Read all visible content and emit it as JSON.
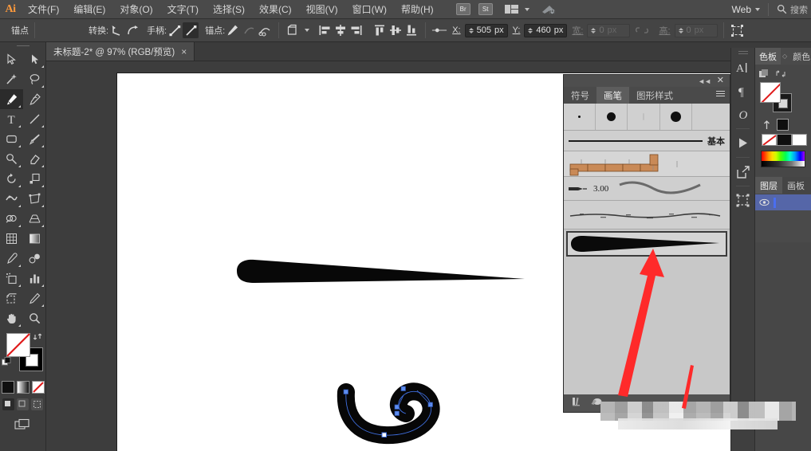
{
  "app": {
    "logo": "Ai",
    "accent_orange": "#ff9a3c",
    "chrome_bg": "#3d3d3d"
  },
  "menubar": {
    "items": [
      {
        "label": "文件(F)"
      },
      {
        "label": "编辑(E)"
      },
      {
        "label": "对象(O)"
      },
      {
        "label": "文字(T)"
      },
      {
        "label": "选择(S)"
      },
      {
        "label": "效果(C)"
      },
      {
        "label": "视图(V)"
      },
      {
        "label": "窗口(W)"
      },
      {
        "label": "帮助(H)"
      }
    ],
    "bridge_button": "Br",
    "stock_button": "St",
    "workspace": "Web",
    "search_placeholder": "搜索"
  },
  "controlbar": {
    "context_label": "锚点",
    "convert_label": "转换:",
    "handles_label": "手柄:",
    "anchors_label": "锚点:",
    "x_label": "X:",
    "x_value": "505",
    "x_unit": "px",
    "y_label": "Y:",
    "y_value": "460",
    "y_unit": "px",
    "w_label": "宽:",
    "w_value": "0",
    "w_unit": "px",
    "h_label": "高:",
    "h_value": "0",
    "h_unit": "px"
  },
  "document": {
    "tab_title": "未标题-2* @ 97% (RGB/预览)",
    "close_label": "×",
    "zoom": "97%",
    "color_mode": "RGB",
    "view_mode": "预览"
  },
  "toolbar": {
    "tools": [
      {
        "name": "selection-tool"
      },
      {
        "name": "direct-selection-tool"
      },
      {
        "name": "magic-wand-tool"
      },
      {
        "name": "lasso-tool"
      },
      {
        "name": "pen-tool",
        "active": true
      },
      {
        "name": "curvature-tool"
      },
      {
        "name": "type-tool"
      },
      {
        "name": "line-segment-tool"
      },
      {
        "name": "rectangle-tool"
      },
      {
        "name": "paintbrush-tool"
      },
      {
        "name": "shaper-tool"
      },
      {
        "name": "eraser-tool"
      },
      {
        "name": "rotate-tool"
      },
      {
        "name": "scale-tool"
      },
      {
        "name": "width-tool"
      },
      {
        "name": "free-transform-tool"
      },
      {
        "name": "shape-builder-tool"
      },
      {
        "name": "perspective-grid-tool"
      },
      {
        "name": "mesh-tool"
      },
      {
        "name": "gradient-tool"
      },
      {
        "name": "eyedropper-tool"
      },
      {
        "name": "blend-tool"
      },
      {
        "name": "symbol-sprayer-tool"
      },
      {
        "name": "column-graph-tool"
      },
      {
        "name": "artboard-tool"
      },
      {
        "name": "slice-tool"
      },
      {
        "name": "hand-tool"
      },
      {
        "name": "zoom-tool"
      }
    ],
    "fill_color": "#ffffff",
    "fill_is_none": true,
    "stroke_color": "#000000",
    "color_mode_buttons": [
      "color-swatch",
      "gradient-swatch",
      "none-swatch"
    ],
    "draw_modes": [
      "draw-normal",
      "draw-behind",
      "draw-inside"
    ]
  },
  "brushes_panel": {
    "tabs": [
      {
        "label": "符号",
        "active": false
      },
      {
        "label": "画笔",
        "active": true
      },
      {
        "label": "图形样式",
        "active": false
      }
    ],
    "thumbnails": [
      {
        "name": "brush-thumb-tiny-dot",
        "size": 3
      },
      {
        "name": "brush-thumb-round-dot",
        "size": 11
      },
      {
        "name": "brush-thumb-soft",
        "size": 2
      },
      {
        "name": "brush-thumb-large-dot",
        "size": 13
      }
    ],
    "brushes": [
      {
        "name": "basic-brush",
        "label": "基本",
        "type": "calligraphic"
      },
      {
        "name": "pattern-brush",
        "label": "",
        "type": "pattern"
      },
      {
        "name": "art-brush-300",
        "label": "3.00",
        "type": "art"
      },
      {
        "name": "charcoal-brush",
        "label": "",
        "type": "bristle"
      },
      {
        "name": "tapered-stroke-brush",
        "label": "",
        "type": "art",
        "selected": true
      }
    ],
    "footer_buttons": [
      "brush-libraries-icon",
      "new-brush-icon"
    ]
  },
  "icon_dock": {
    "items": [
      {
        "name": "character-panel-icon",
        "glyph": "A"
      },
      {
        "name": "paragraph-panel-icon",
        "glyph": "¶"
      },
      {
        "name": "opentype-panel-icon",
        "glyph": "O"
      },
      {
        "name": "actions-panel-icon",
        "glyph": "▶"
      },
      {
        "name": "asset-export-panel-icon",
        "glyph": "⬈"
      },
      {
        "name": "artboards-panel-icon",
        "glyph": "⬚"
      }
    ]
  },
  "right_panels": {
    "swatches_tab": "色板",
    "swatches_tab2": "颜色",
    "layers_tab": "图层",
    "layers_tab2": "画板",
    "layer_row_name": "",
    "fill_color": "#ffffff",
    "stroke_color": "#1a1a1a",
    "accent_selection": "#5566a8"
  },
  "artwork": {
    "tapered_stroke_name": "tapered-brush-stroke-shape",
    "curved_path_name": "selected-curved-brush-path",
    "anchor_color": "#3f6fe0",
    "stroke_color": "#000000"
  },
  "annotations": {
    "arrow_color": "#ff2a2a",
    "main_arrow_name": "red-annotation-arrow",
    "secondary_arrow_name": "red-annotation-line"
  }
}
